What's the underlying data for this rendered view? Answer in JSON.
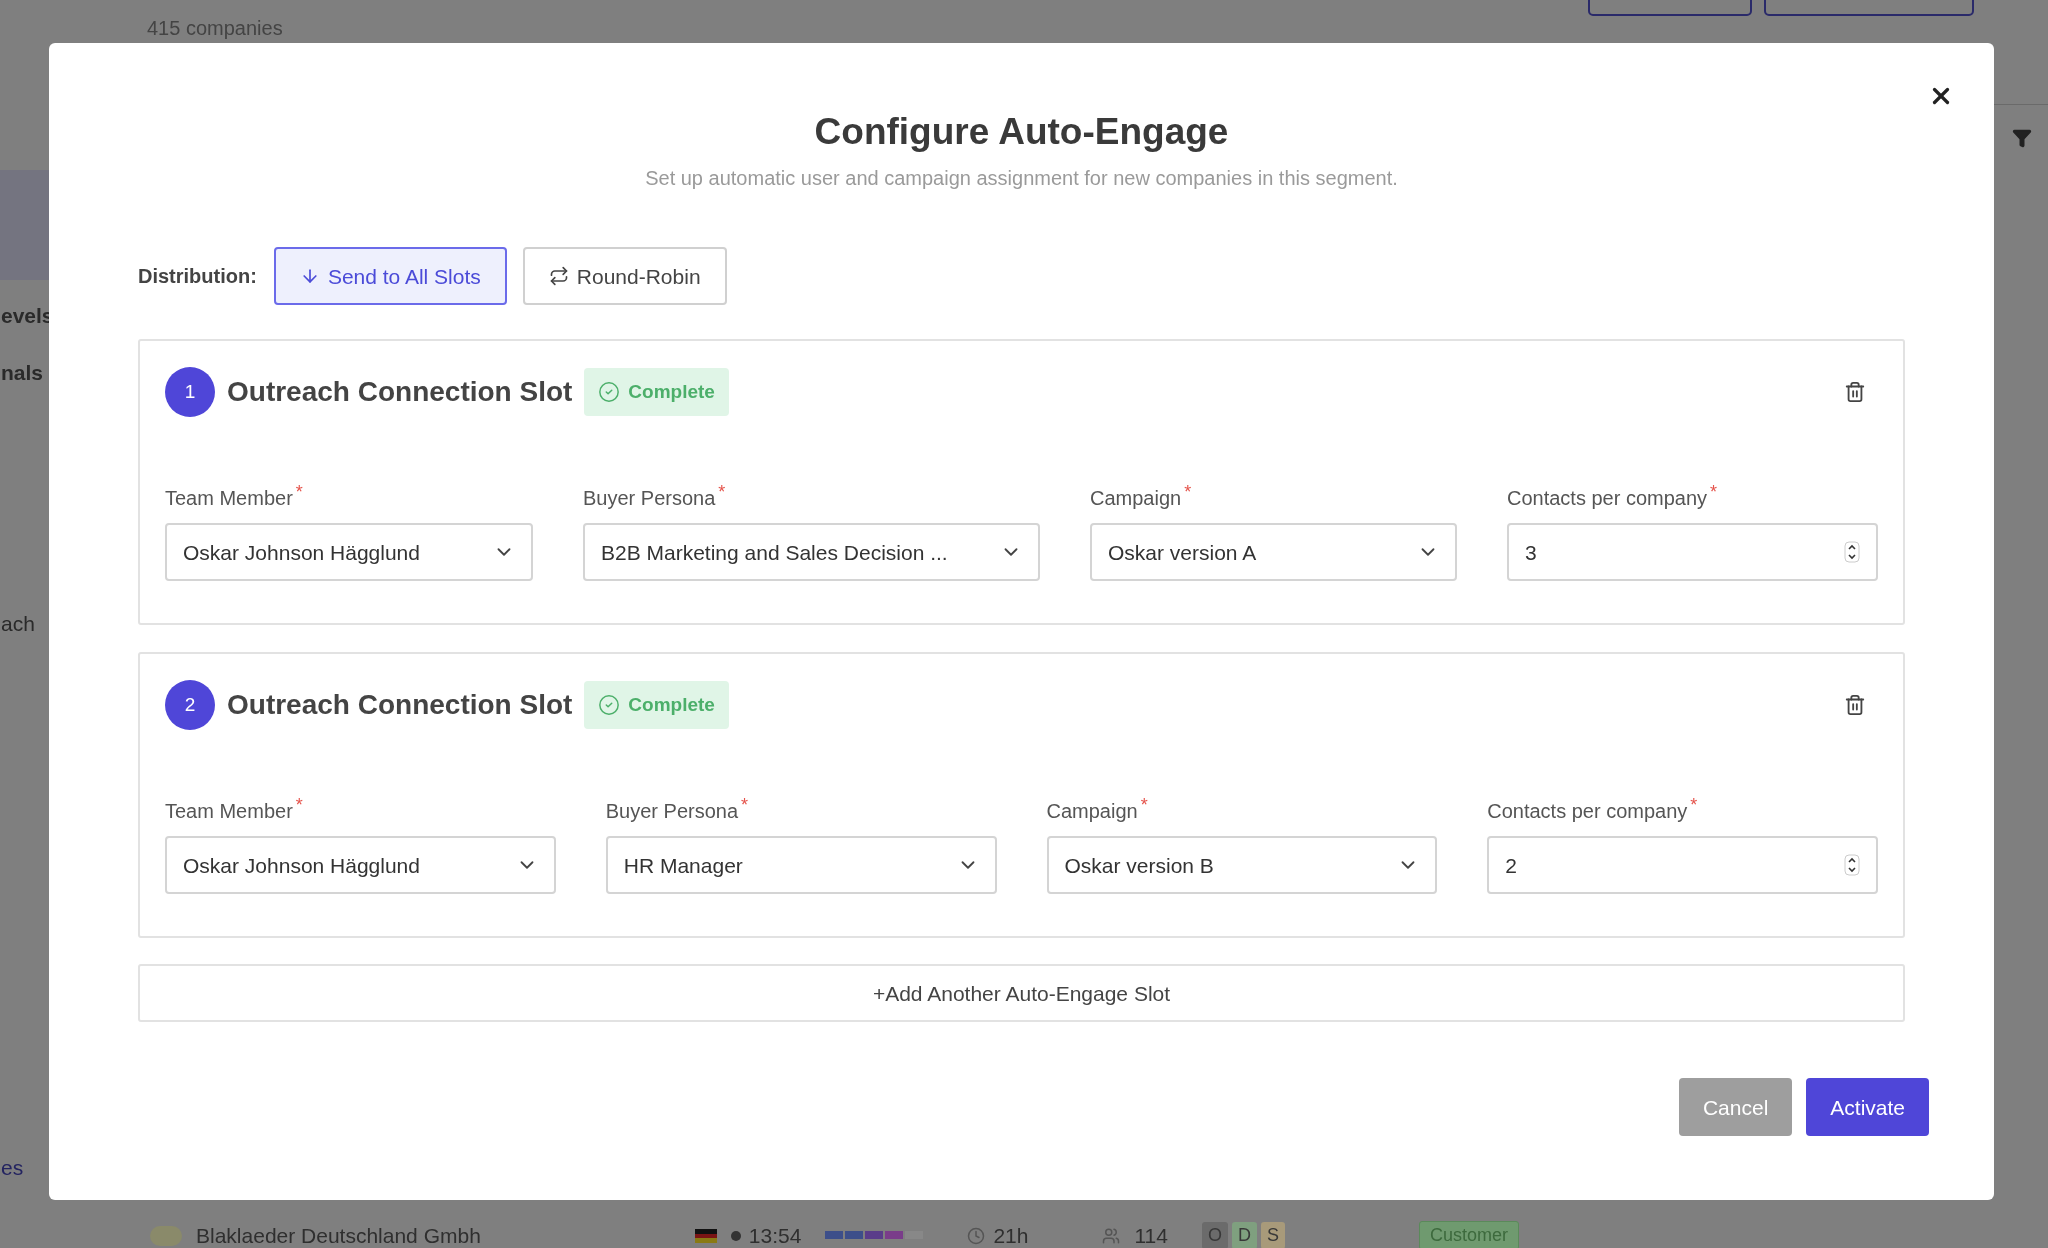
{
  "background": {
    "subtitle": "415 companies",
    "sidebar_items": [
      "evels",
      "nals",
      "ach",
      "es"
    ],
    "row": {
      "name": "Blaklaeder Deutschland Gmbh",
      "time": "13:54",
      "duration": "21h",
      "people": "114",
      "tags": [
        {
          "label": "O",
          "color": "#6b6b6b"
        },
        {
          "label": "D",
          "color": "#7fa07f"
        },
        {
          "label": "S",
          "color": "#a89a7a"
        }
      ],
      "status": "Customer"
    }
  },
  "dialog": {
    "title": "Configure Auto-Engage",
    "subtitle": "Set up automatic user and campaign assignment for new companies in this segment.",
    "distribution": {
      "label": "Distribution:",
      "options": [
        {
          "label": "Send to All Slots",
          "kind": "all",
          "selected": true
        },
        {
          "label": "Round-Robin",
          "kind": "round-robin",
          "selected": false
        }
      ]
    },
    "slots": [
      {
        "number": "1",
        "title": "Outreach Connection Slot",
        "status": "Complete",
        "fields": [
          {
            "label": "Team Member",
            "required_mark": "*",
            "kind": "select",
            "value": "Oskar Johnson Hägglund"
          },
          {
            "label": "Buyer Persona",
            "required_mark": "*",
            "kind": "select",
            "value": "B2B Marketing and Sales Decision ..."
          },
          {
            "label": "Campaign",
            "required_mark": "*",
            "kind": "select",
            "value": "Oskar version A"
          },
          {
            "label": "Contacts per company",
            "required_mark": "*",
            "kind": "number",
            "value": "3"
          }
        ]
      },
      {
        "number": "2",
        "title": "Outreach Connection Slot",
        "status": "Complete",
        "fields": [
          {
            "label": "Team Member",
            "required_mark": "*",
            "kind": "select",
            "value": "Oskar Johnson Hägglund"
          },
          {
            "label": "Buyer Persona",
            "required_mark": "*",
            "kind": "select",
            "value": "HR Manager"
          },
          {
            "label": "Campaign",
            "required_mark": "*",
            "kind": "select",
            "value": "Oskar version B"
          },
          {
            "label": "Contacts per company",
            "required_mark": "*",
            "kind": "number",
            "value": "2"
          }
        ]
      }
    ],
    "add_button": "+Add Another Auto-Engage Slot",
    "buttons": [
      {
        "label": "Cancel",
        "kind": "secondary"
      },
      {
        "label": "Activate",
        "kind": "primary"
      }
    ]
  }
}
